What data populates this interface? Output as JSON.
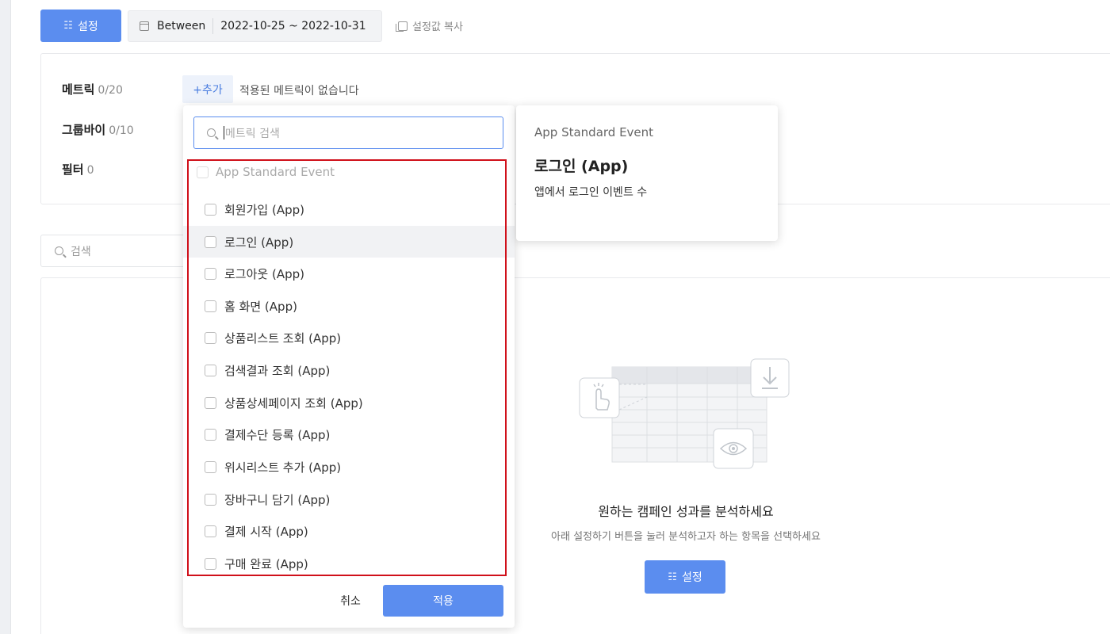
{
  "toolbar": {
    "settings_label": "설정",
    "settings_icon": "sliders-icon",
    "date_mode": "Between",
    "date_range": "2022-10-25 ~ 2022-10-31",
    "copy_label": "설정값 복사"
  },
  "settings": {
    "metric_label": "메트릭",
    "metric_count": "0/20",
    "groupby_label": "그룹바이",
    "groupby_count": "0/10",
    "filter_label": "필터",
    "filter_count": "0",
    "add_label": "+추가",
    "no_metric_text": "적용된 메트릭이 없습니다"
  },
  "search": {
    "placeholder": "검색"
  },
  "dropdown": {
    "search_placeholder": "메트릭 검색",
    "group_label": "App Standard Event",
    "items": [
      {
        "label": "회원가입 (App)",
        "checked": false
      },
      {
        "label": "로그인 (App)",
        "checked": false
      },
      {
        "label": "로그아웃 (App)",
        "checked": false
      },
      {
        "label": "홈 화면 (App)",
        "checked": false
      },
      {
        "label": "상품리스트 조회 (App)",
        "checked": false
      },
      {
        "label": "검색결과 조회 (App)",
        "checked": false
      },
      {
        "label": "상품상세페이지 조회 (App)",
        "checked": false
      },
      {
        "label": "결제수단 등록 (App)",
        "checked": false
      },
      {
        "label": "위시리스트 추가 (App)",
        "checked": false
      },
      {
        "label": "장바구니 담기 (App)",
        "checked": false
      },
      {
        "label": "결제 시작 (App)",
        "checked": false
      },
      {
        "label": "구매 완료 (App)",
        "checked": false
      }
    ],
    "hovered_item": "로그인 (App)",
    "cancel_label": "취소",
    "apply_label": "적용"
  },
  "tooltip": {
    "category": "App Standard Event",
    "name": "로그인 (App)",
    "description": "앱에서 로그인 이벤트 수"
  },
  "empty_state": {
    "title": "원하는 캠페인 성과를 분석하세요",
    "description": "아래 설정하기 버튼을 눌러 분석하고자 하는 항목을 선택하세요",
    "button_label": "설정",
    "illustration_icons": [
      "touch-hand-icon",
      "download-icon",
      "eye-icon"
    ]
  },
  "colors": {
    "primary": "#5b8def",
    "highlight_border": "#d0101a",
    "hover_row": "#f1f2f4"
  }
}
